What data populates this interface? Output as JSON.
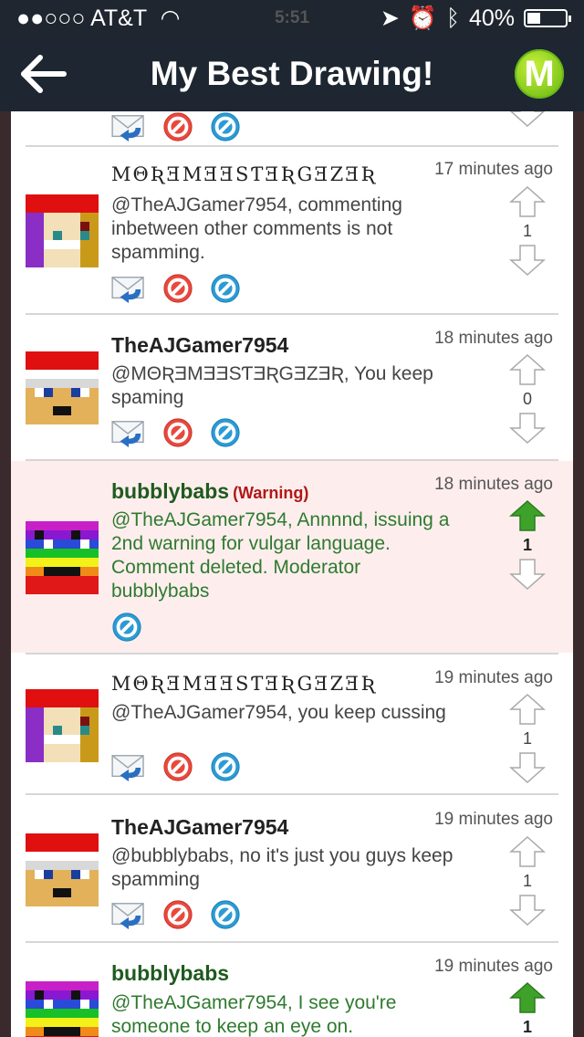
{
  "status_bar": {
    "carrier": "●●○○○ AT&T",
    "wifi_icon": "wifi-icon",
    "time": "5:51",
    "battery": "40%",
    "battery_level": 0.4
  },
  "nav": {
    "title": "My Best Drawing!",
    "back_icon": "back-arrow-icon",
    "badge": "M",
    "accent": "#7fc71a"
  },
  "comments": [
    {
      "author": "ΜΘƦƎΜƎƎSƬƎƦGƎZƎƦ",
      "time": "17 minutes ago",
      "text": "@TheAJGamer7954, commenting inbetween other comments is not spamming.",
      "votes": "1"
    },
    {
      "author": "TheAJGamer7954",
      "time": "18 minutes ago",
      "text": "@ΜΘƦƎΜƎƎSƬƎƦGƎZƎƦ, You keep spaming",
      "votes": "0"
    },
    {
      "author": "bubblybabs",
      "warning": "(Warning)",
      "time": "18 minutes ago",
      "text": "@TheAJGamer7954, Annnnd, issuing a 2nd warning for vulgar language. Comment deleted. Moderator bubblybabs",
      "votes": "1"
    },
    {
      "author": "ΜΘƦƎΜƎƎSƬƎƦGƎZƎƦ",
      "time": "19 minutes ago",
      "text": "@TheAJGamer7954, you keep cussing",
      "votes": "1"
    },
    {
      "author": "TheAJGamer7954",
      "time": "19 minutes ago",
      "text": "@bubblybabs, no it's just you guys keep spamming",
      "votes": "1"
    },
    {
      "author": "bubblybabs",
      "time": "19 minutes ago",
      "text": "@TheAJGamer7954, I see you're someone to keep an eye on.",
      "votes": "1"
    }
  ]
}
